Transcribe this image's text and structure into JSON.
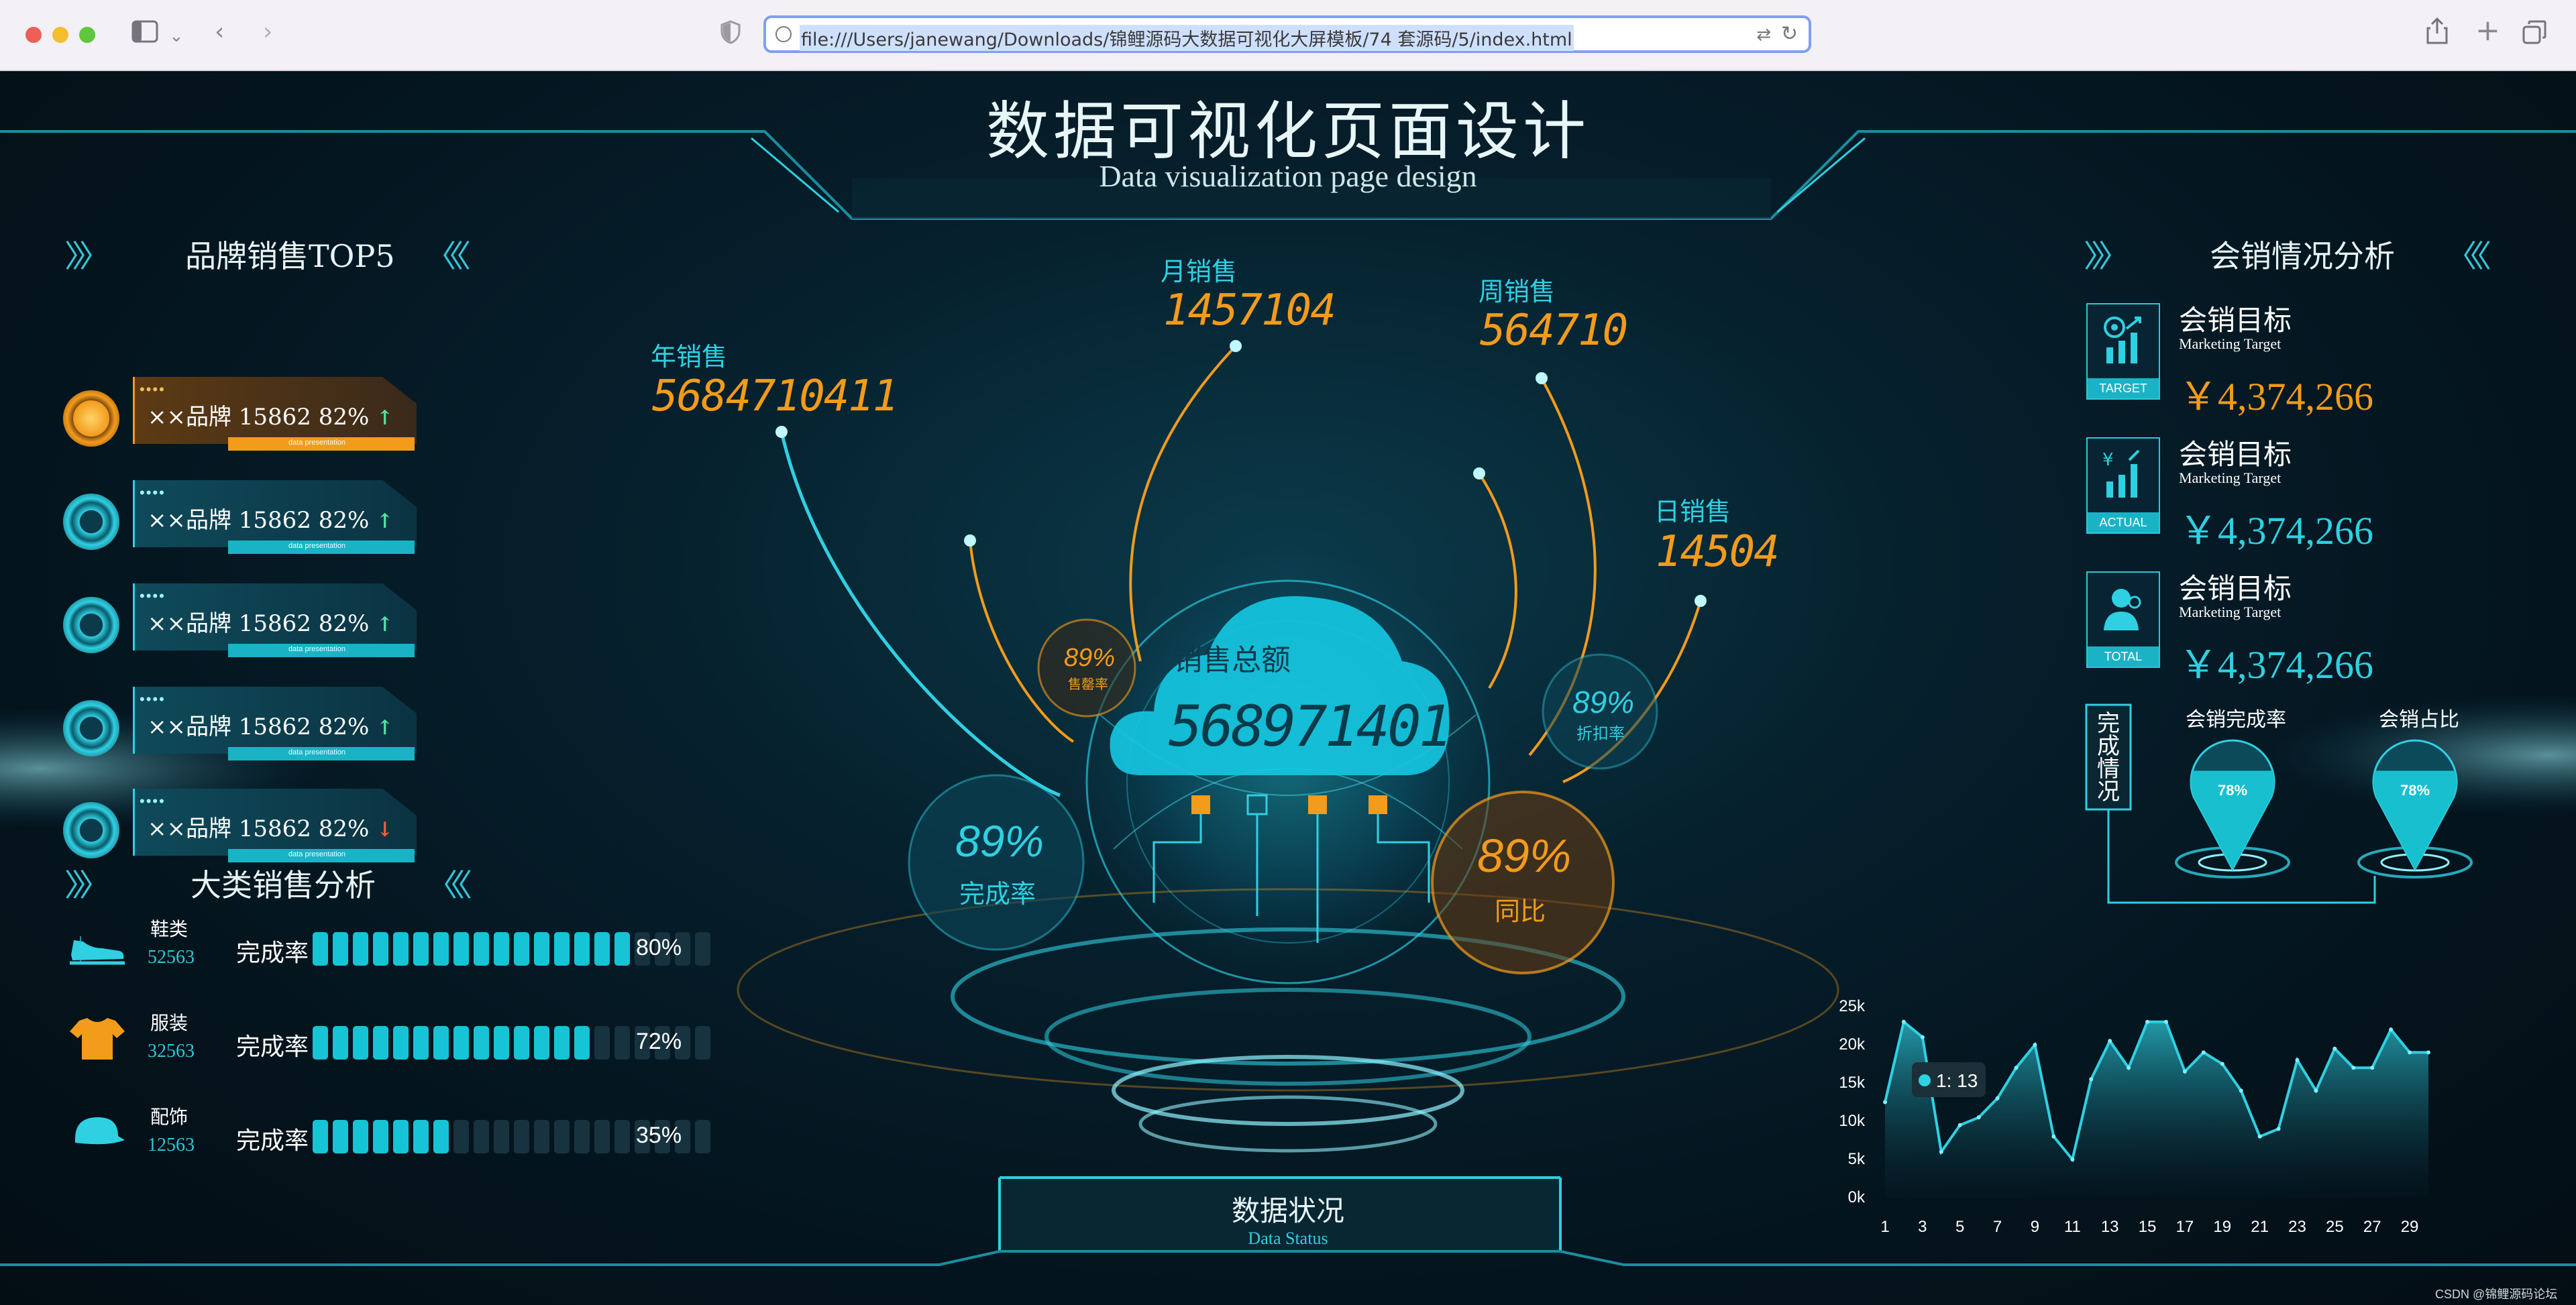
{
  "browser": {
    "url": "file:///Users/janewang/Downloads/锦鲤源码大数据可视化大屏模板/74 套源码/5/index.html",
    "icons": [
      "sidebar-icon",
      "chevron-down-icon",
      "back-icon",
      "forward-icon",
      "shield-icon",
      "translate-icon",
      "reload-icon",
      "share-icon",
      "new-tab-icon",
      "tabs-overview-icon"
    ]
  },
  "header": {
    "title": "数据可视化页面设计",
    "subtitle": "Data visualization page design"
  },
  "brand_panel": {
    "title": "品牌销售TOP5",
    "items": [
      {
        "text": "××品牌  15862  82%",
        "trend": "up",
        "tag": "data presentation"
      },
      {
        "text": "××品牌  15862  82%",
        "trend": "up",
        "tag": "data presentation"
      },
      {
        "text": "××品牌  15862  82%",
        "trend": "up",
        "tag": "data presentation"
      },
      {
        "text": "××品牌  15862  82%",
        "trend": "up",
        "tag": "data presentation"
      },
      {
        "text": "××品牌  15862  82%",
        "trend": "down",
        "tag": "data presentation"
      }
    ],
    "up_arrow": "↑",
    "down_arrow": "↓"
  },
  "category_panel": {
    "title": "大类销售分析",
    "items": [
      {
        "name": "鞋类",
        "number": "52563",
        "label": "完成率",
        "percent": "80%",
        "progress": 0.8,
        "icon": "shoe-icon"
      },
      {
        "name": "服装",
        "number": "32563",
        "label": "完成率",
        "percent": "72%",
        "progress": 0.72,
        "icon": "shirt-icon"
      },
      {
        "name": "配饰",
        "number": "12563",
        "label": "完成率",
        "percent": "35%",
        "progress": 0.35,
        "icon": "cap-icon"
      }
    ]
  },
  "center": {
    "year_label": "年销售",
    "year_value": "5684710411",
    "month_label": "月销售",
    "month_value": "1457104",
    "week_label": "周销售",
    "week_value": "564710",
    "day_label": "日销售",
    "day_value": "14504",
    "total_label": "销售总额",
    "total_value": "568971401",
    "bubble_small_left_value": "89%",
    "bubble_small_left_label": "售罄率",
    "bubble_small_right_value": "89%",
    "bubble_small_right_label": "折扣率",
    "bubble_big_left_value": "89%",
    "bubble_big_left_label": "完成率",
    "bubble_big_right_value": "89%",
    "bubble_big_right_label": "同比",
    "status_title": "数据状况",
    "status_sub": "Data Status"
  },
  "right_panel": {
    "title": "会销情况分析",
    "kpis": [
      {
        "title": "会销目标",
        "sub": "Marketing Target",
        "value": "￥4,374,266",
        "tag": "TARGET",
        "color": "#f39b1b",
        "icon": "target-chart-icon"
      },
      {
        "title": "会销目标",
        "sub": "Marketing Target",
        "value": "￥4,374,266",
        "tag": "ACTUAL",
        "color": "#2fd0e2",
        "icon": "yen-chart-icon"
      },
      {
        "title": "会销目标",
        "sub": "Marketing Target",
        "value": "￥4,374,266",
        "tag": "TOTAL",
        "color": "#2fd0e2",
        "icon": "user-icon"
      }
    ],
    "completion_box": "完成情况",
    "drops": [
      {
        "label": "会销完成率",
        "value": "78%",
        "level": 0.78
      },
      {
        "label": "会销占比",
        "value": "78%",
        "level": 0.78
      }
    ]
  },
  "chart_data": {
    "type": "area",
    "title": "",
    "xlabel": "",
    "ylabel": "",
    "x_ticks": [
      "1",
      "3",
      "5",
      "7",
      "9",
      "11",
      "13",
      "15",
      "17",
      "19",
      "21",
      "23",
      "25",
      "27",
      "29"
    ],
    "y_ticks": [
      "0k",
      "5k",
      "10k",
      "15k",
      "20k",
      "25k"
    ],
    "ylim": [
      0,
      25000
    ],
    "x": [
      1,
      2,
      3,
      4,
      5,
      6,
      7,
      8,
      9,
      10,
      11,
      12,
      13,
      14,
      15,
      16,
      17,
      18,
      19,
      20,
      21,
      22,
      23,
      24,
      25,
      26,
      27,
      28,
      29,
      30
    ],
    "values": [
      12500,
      23000,
      21000,
      6000,
      9500,
      10500,
      13000,
      17000,
      20000,
      8000,
      5000,
      15500,
      20500,
      17000,
      23000,
      23000,
      16500,
      19000,
      17500,
      14000,
      8000,
      9000,
      18000,
      14000,
      19500,
      17000,
      17000,
      22000,
      19000,
      19000
    ],
    "tooltip": "1: 13"
  },
  "footer": {
    "watermark": "CSDN @锦鲤源码论坛"
  }
}
